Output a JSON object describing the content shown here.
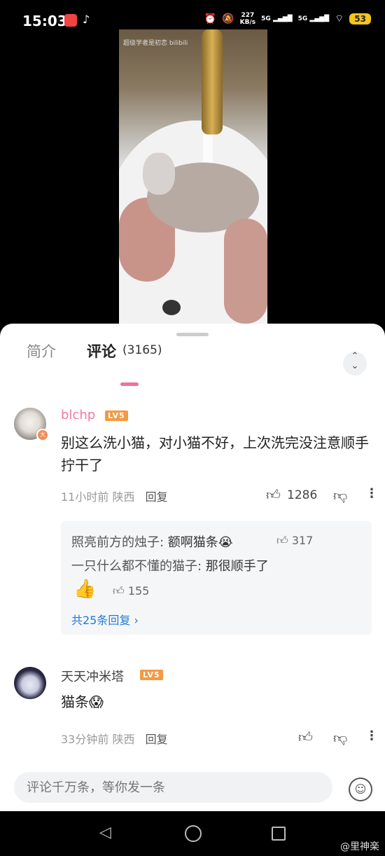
{
  "status_bar": {
    "time": "15:03",
    "network_speed": "227\nKB/s",
    "signal1": "5G",
    "signal2": "5G",
    "battery": "53"
  },
  "video": {
    "watermark": "超级学者是初恋 bilibili"
  },
  "tabs": {
    "intro": "简介",
    "comments": "评论",
    "comment_count": "(3165)"
  },
  "comments": [
    {
      "username": "blchp",
      "level": "LV5",
      "text": "别这么洗小猫，对小猫不好，上次洗完没注意顺手拧干了",
      "time": "11小时前",
      "location": "陕西",
      "reply_label": "回复",
      "likes": "1286",
      "replies": [
        {
          "name": "照亮前方的烛子:",
          "text": " 额啊猫条😭",
          "likes": "317"
        },
        {
          "name": "一只什么都不懂的猫子:",
          "text": " 那很顺手了",
          "emoji": "👍",
          "likes": "155"
        }
      ],
      "more_replies": "共25条回复 ›"
    },
    {
      "username": "天天冲米塔",
      "level": "LV5",
      "text": "猫条😱",
      "time": "33分钟前",
      "location": "陕西",
      "reply_label": "回复"
    }
  ],
  "composer": {
    "placeholder": "评论千万条，等你发一条"
  },
  "watermark": "@里神楽",
  "colors": {
    "accent": "#f0729a",
    "username": "#f07aa0",
    "level_badge": "#f39a42",
    "link": "#1e7bd9"
  }
}
